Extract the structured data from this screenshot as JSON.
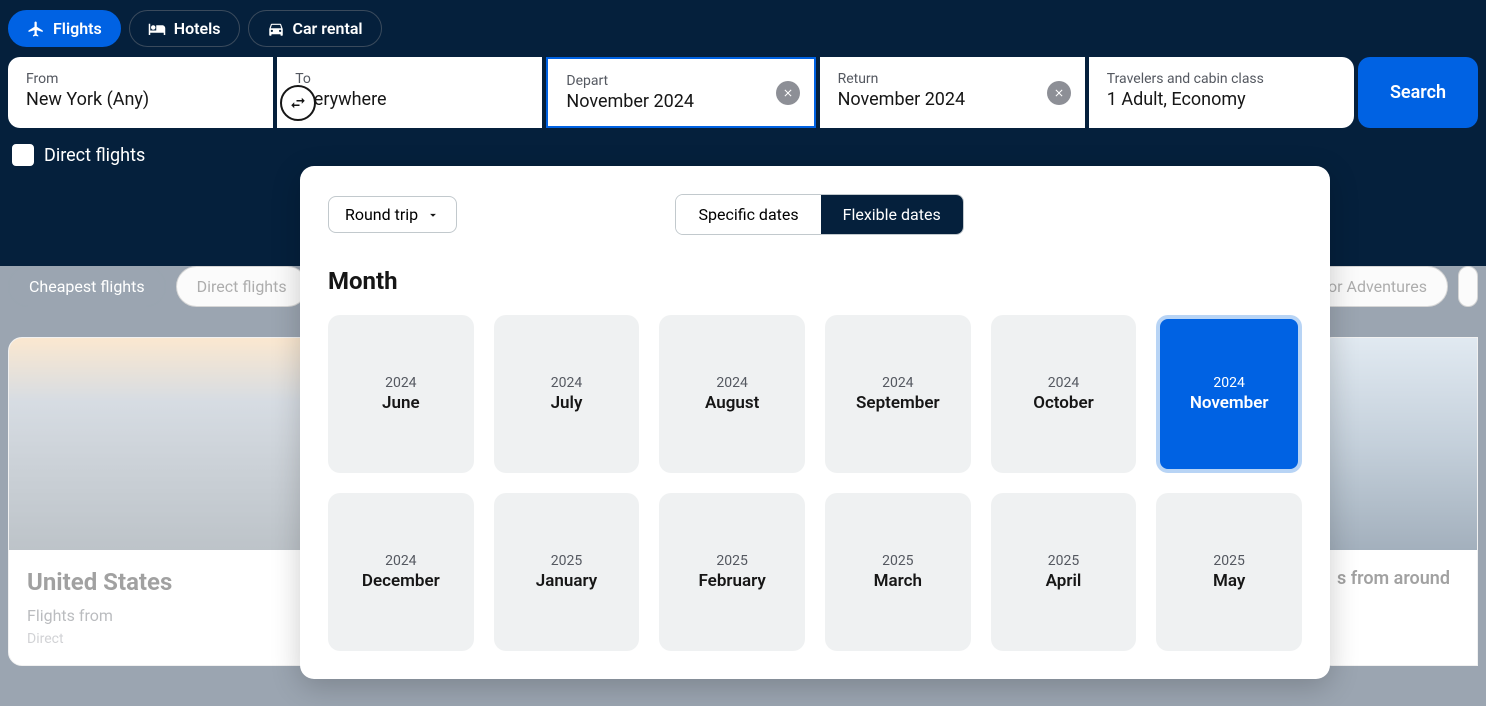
{
  "tabs": {
    "flights": "Flights",
    "hotels": "Hotels",
    "car_rental": "Car rental"
  },
  "search": {
    "from_label": "From",
    "from_value": "New York (Any)",
    "to_label": "To",
    "to_value": "Everywhere",
    "depart_label": "Depart",
    "depart_value": "November 2024",
    "return_label": "Return",
    "return_value": "November 2024",
    "travelers_label": "Travelers and cabin class",
    "travelers_value": "1 Adult, Economy",
    "search_btn": "Search"
  },
  "direct_label": "Direct flights",
  "chips": {
    "cheapest": "Cheapest flights",
    "direct": "Direct flights",
    "outdoor": "or Adventures"
  },
  "cards": {
    "us_title": "United States",
    "us_sub": "Flights from",
    "us_tag": "Direct",
    "right_text": "s from around"
  },
  "popup": {
    "trip_type": "Round trip",
    "specific": "Specific dates",
    "flexible": "Flexible dates",
    "month_heading": "Month",
    "months": [
      {
        "year": "2024",
        "name": "June",
        "selected": false
      },
      {
        "year": "2024",
        "name": "July",
        "selected": false
      },
      {
        "year": "2024",
        "name": "August",
        "selected": false
      },
      {
        "year": "2024",
        "name": "September",
        "selected": false
      },
      {
        "year": "2024",
        "name": "October",
        "selected": false
      },
      {
        "year": "2024",
        "name": "November",
        "selected": true
      },
      {
        "year": "2024",
        "name": "December",
        "selected": false
      },
      {
        "year": "2025",
        "name": "January",
        "selected": false
      },
      {
        "year": "2025",
        "name": "February",
        "selected": false
      },
      {
        "year": "2025",
        "name": "March",
        "selected": false
      },
      {
        "year": "2025",
        "name": "April",
        "selected": false
      },
      {
        "year": "2025",
        "name": "May",
        "selected": false
      }
    ]
  }
}
